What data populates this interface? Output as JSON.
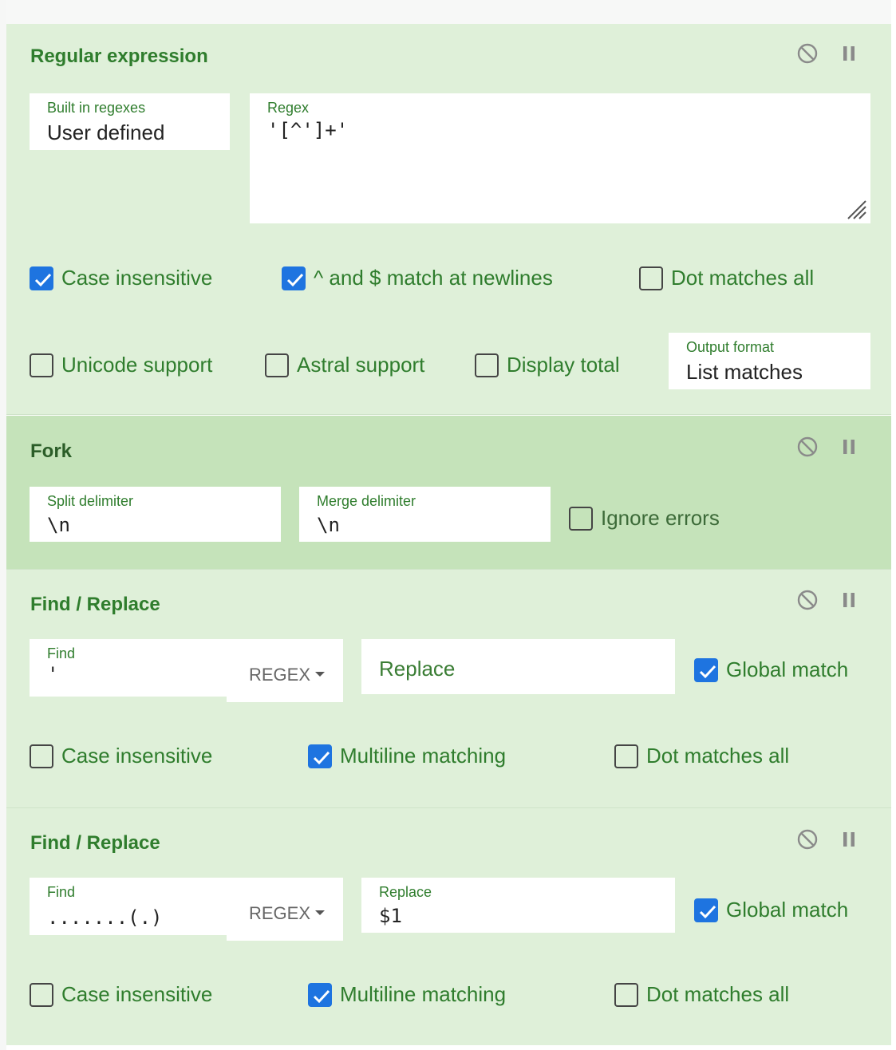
{
  "regex_op": {
    "title": "Regular expression",
    "builtin_label": "Built in regexes",
    "builtin_value": "User defined",
    "regex_label": "Regex",
    "regex_value": "'[^']+'",
    "case_insensitive": "Case insensitive",
    "multiline": "^ and $ match at newlines",
    "dot_all": "Dot matches all",
    "unicode": "Unicode support",
    "astral": "Astral support",
    "display_total": "Display total",
    "output_label": "Output format",
    "output_value": "List matches"
  },
  "fork_op": {
    "title": "Fork",
    "split_label": "Split delimiter",
    "split_value": "\\n",
    "merge_label": "Merge delimiter",
    "merge_value": "\\n",
    "ignore_errors": "Ignore errors"
  },
  "find_replace_1": {
    "title": "Find / Replace",
    "find_label": "Find",
    "find_value": "'",
    "find_type": "REGEX",
    "replace_placeholder": "Replace",
    "global": "Global match",
    "case_insensitive": "Case insensitive",
    "multiline": "Multiline matching",
    "dot_all": "Dot matches all"
  },
  "find_replace_2": {
    "title": "Find / Replace",
    "find_label": "Find",
    "find_value": ".......(.)",
    "find_type": "REGEX",
    "replace_label": "Replace",
    "replace_value": "$1",
    "global": "Global match",
    "case_insensitive": "Case insensitive",
    "multiline": "Multiline matching",
    "dot_all": "Dot matches all"
  },
  "icons": {
    "disable": "disable-icon",
    "pause": "breakpoint-pause-icon"
  },
  "colors": {
    "op_bg": "#dff0d9",
    "fork_bg": "#c5e3ba",
    "accent_green": "#2f7d2d",
    "checkbox_blue": "#1e74e0"
  }
}
